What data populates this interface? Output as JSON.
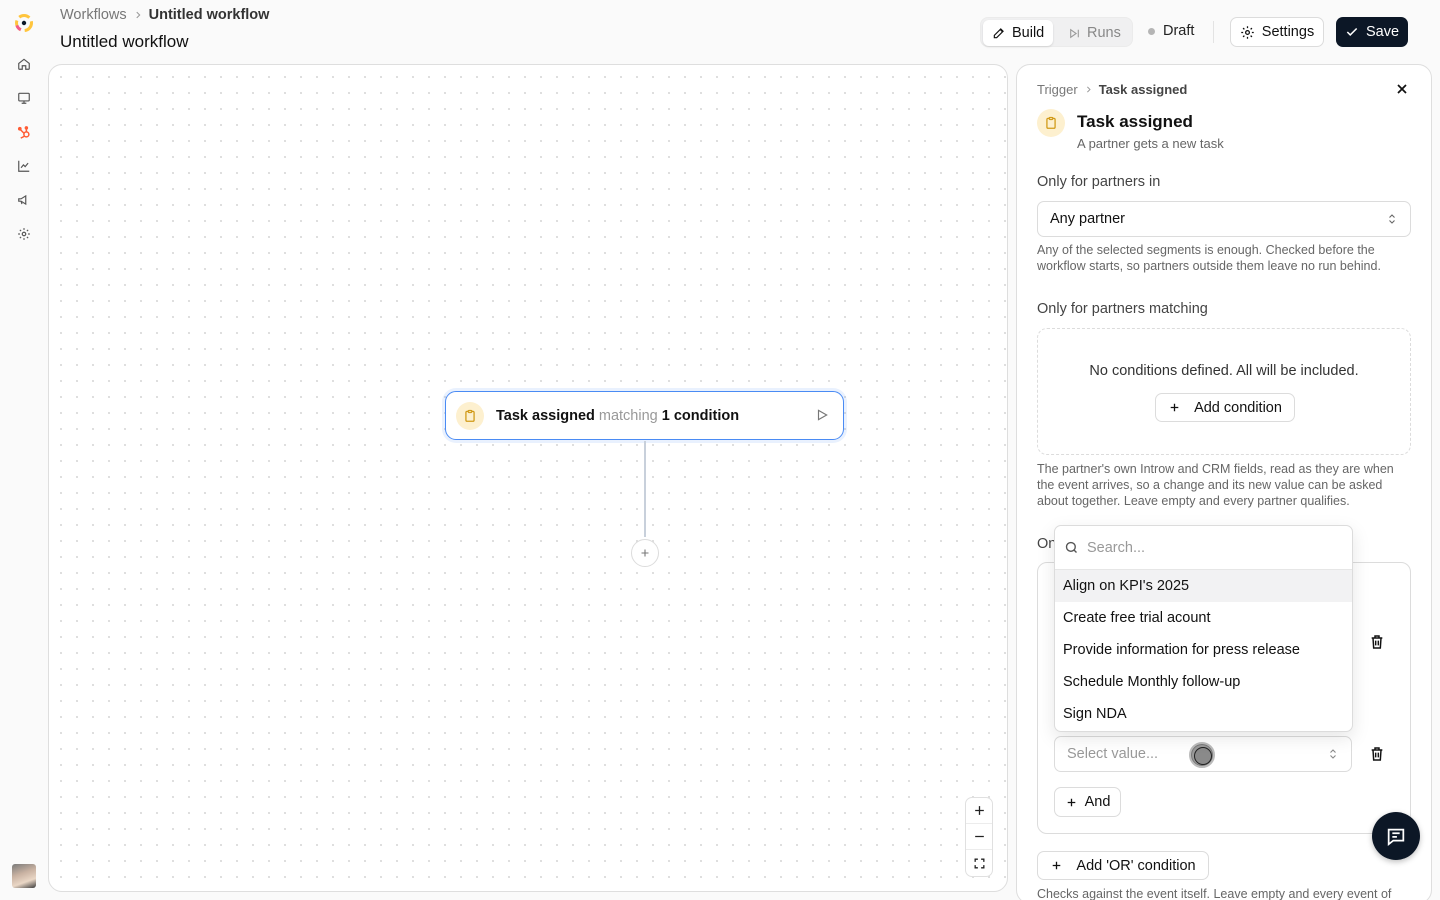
{
  "breadcrumb": {
    "root": "Workflows",
    "current": "Untitled workflow"
  },
  "page_title": "Untitled workflow",
  "header": {
    "tab_build": "Build",
    "tab_runs": "Runs",
    "status": "Draft",
    "settings_label": "Settings",
    "save_label": "Save"
  },
  "sidebar": {
    "items": [
      "home-icon",
      "desktop-icon",
      "hubspot-icon",
      "chart-icon",
      "megaphone-icon",
      "gear-icon"
    ]
  },
  "canvas": {
    "node": {
      "name": "Task assigned",
      "connector": "matching",
      "conditions": "1 condition"
    }
  },
  "panel": {
    "breadcrumb_root": "Trigger",
    "breadcrumb_current": "Task assigned",
    "title": "Task assigned",
    "subtitle": "A partner gets a new task",
    "segments_label": "Only for partners in",
    "segments_value": "Any partner",
    "segments_help": "Any of the selected segments is enough. Checked before the workflow starts, so partners outside them leave no run behind.",
    "matching_label": "Only for partners matching",
    "no_conditions": "No conditions defined. All will be included.",
    "add_condition": "Add condition",
    "matching_help": "The partner's own Introw and CRM fields, read as they are when the event arrives, so a change and its new value can be asked about together. Leave empty and every partner qualifies.",
    "event_label_partial": "On",
    "select_value_placeholder": "Select value...",
    "and_label": "And",
    "or_condition_label": "Add 'OR' condition",
    "bottom_help_partial": "Checks against the event itself. Leave empty and every event of"
  },
  "dropdown": {
    "search_placeholder": "Search...",
    "options": [
      "Align on KPI's 2025",
      "Create free trial acount",
      "Provide information for press release",
      "Schedule Monthly follow-up",
      "Sign NDA"
    ],
    "highlighted_index": 0
  },
  "colors": {
    "accent": "#4a8bf4",
    "dark": "#0c1726",
    "trigger_bg": "#fdf0cf",
    "trigger_icon": "#d19a18",
    "hubspot": "#ff5c35"
  }
}
